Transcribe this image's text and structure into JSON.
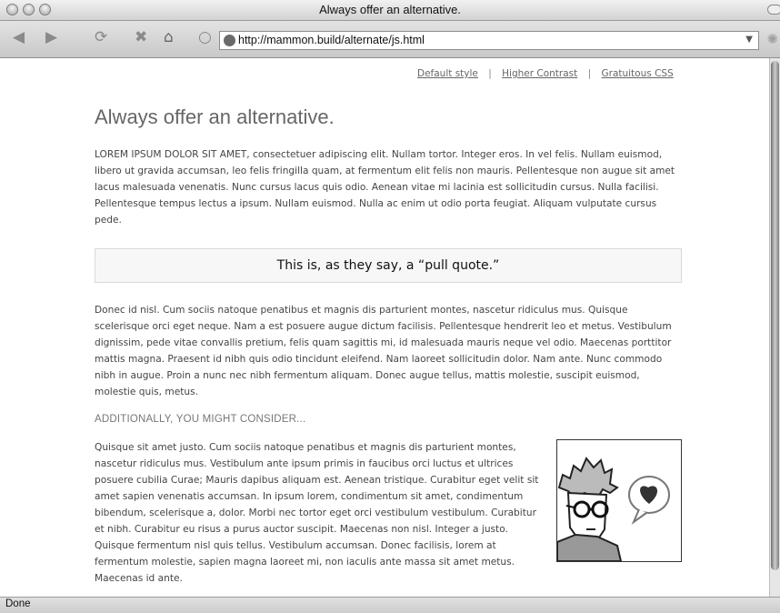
{
  "window": {
    "title": "Always offer an alternative."
  },
  "toolbar": {
    "back_icon": "back-arrow-icon",
    "forward_icon": "forward-arrow-icon",
    "reload_icon": "reload-icon",
    "stop_icon": "stop-icon",
    "home_icon": "home-icon",
    "url": "http://mammon.build/alternate/js.html"
  },
  "style_switcher": {
    "links": [
      "Default style",
      "Higher Contrast",
      "Gratuitous CSS"
    ],
    "separator": "|"
  },
  "page": {
    "title": "Always offer an alternative.",
    "intro_lead": "LOREM IPSUM DOLOR SIT AMET,",
    "intro": "consectetuer adipiscing elit. Nullam tortor. Integer eros. In vel felis. Nullam euismod, libero ut gravida accumsan, leo felis fringilla quam, at fermentum elit felis non mauris. Pellentesque non augue sit amet lacus malesuada venenatis. Nunc cursus lacus quis odio. Aenean vitae mi lacinia est sollicitudin cursus. Nulla facilisi. Pellentesque tempus lectus a ipsum. Nullam euismod. Nulla ac enim ut odio porta feugiat. Aliquam vulputate cursus pede.",
    "pull_quote": "This is, as they say, a “pull quote.”",
    "body": "Donec id nisl. Cum sociis natoque penatibus et magnis dis parturient montes, nascetur ridiculus mus. Quisque scelerisque orci eget neque. Nam a est posuere augue dictum facilisis. Pellentesque hendrerit leo et metus. Vestibulum dignissim, pede vitae convallis pretium, felis quam sagittis mi, id malesuada mauris neque vel odio. Maecenas porttitor mattis magna. Praesent id nibh quis odio tincidunt eleifend. Nam laoreet sollicitudin dolor. Nam ante. Nunc commodo nibh in augue. Proin a nunc nec nibh fermentum aliquam. Donec augue tellus, mattis molestie, suscipit euismod, molestie quis, metus.",
    "section_heading": "ADDITIONALLY, YOU MIGHT CONSIDER...",
    "final_paragraph": "Quisque sit amet justo. Cum sociis natoque penatibus et magnis dis parturient montes, nascetur ridiculus mus. Vestibulum ante ipsum primis in faucibus orci luctus et ultrices posuere cubilia Curae; Mauris dapibus aliquam est. Aenean tristique. Curabitur eget velit sit amet sapien venenatis accumsan. In ipsum lorem, condimentum sit amet, condimentum bibendum, scelerisque a, dolor. Morbi nec tortor eget orci vestibulum vestibulum. Curabitur et nibh. Curabitur eu risus a purus auctor suscipit. Maecenas non nisl. Integer a justo. Quisque fermentum nisl quis tellus. Vestibulum accumsan. Donec facilisis, lorem at fermentum molestie, sapien magna laoreet mi, non iaculis ante massa sit amet metus. Maecenas id ante.",
    "figure_icon": "avatar-with-heart-speech-bubble"
  },
  "status": {
    "text": "Done"
  }
}
